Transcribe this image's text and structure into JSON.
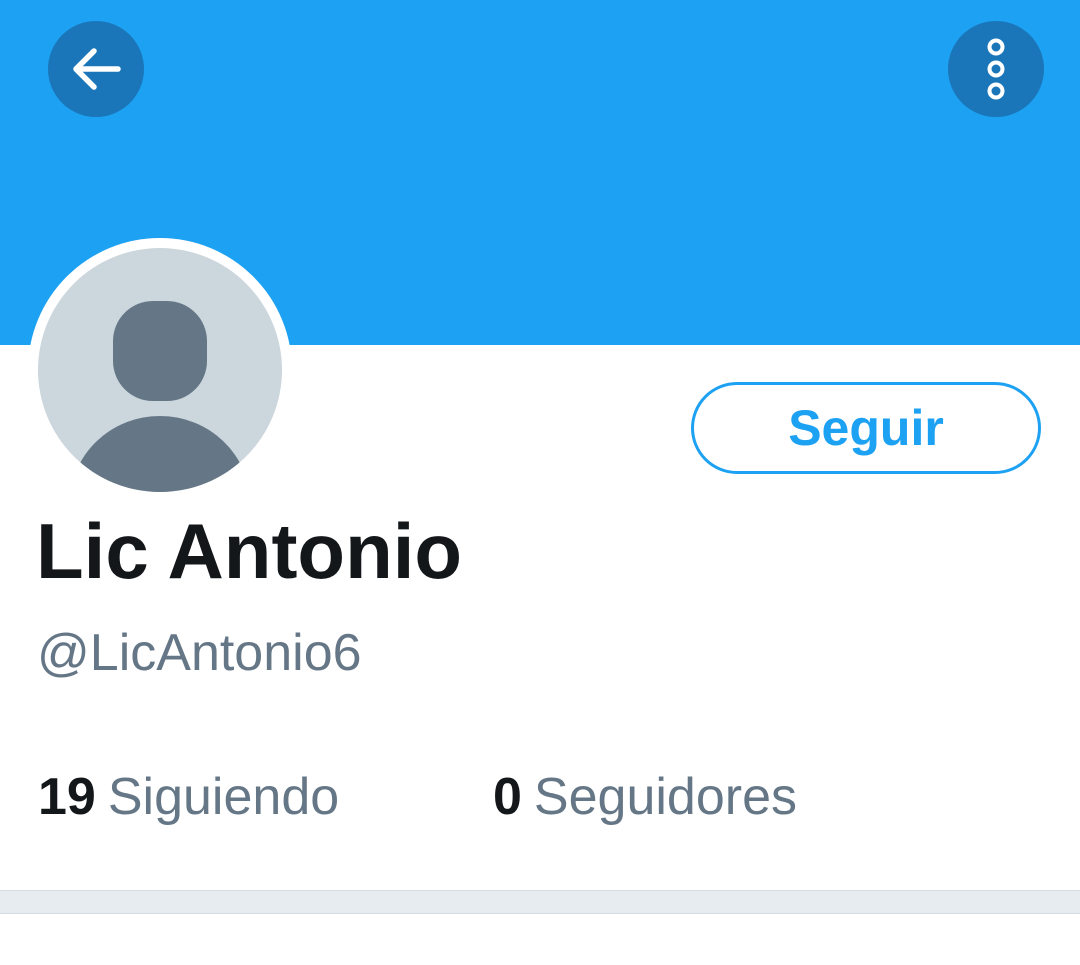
{
  "header": {
    "back_icon": "arrow-left-icon",
    "more_icon": "more-vertical-icon",
    "banner_color": "#1da1f2",
    "button_color": "#1a76b8"
  },
  "profile": {
    "avatar_icon": "default-avatar-icon",
    "display_name": "Lic Antonio",
    "handle": "@LicAntonio6",
    "follow_label": "Seguir"
  },
  "stats": {
    "following_count": "19",
    "following_label": "Siguiendo",
    "followers_count": "0",
    "followers_label": "Seguidores"
  },
  "colors": {
    "accent": "#1da1f2",
    "text_primary": "#14171a",
    "text_secondary": "#657786",
    "avatar_bg": "#ccd6dd",
    "avatar_fg": "#657786",
    "divider": "#e6ecf0"
  }
}
